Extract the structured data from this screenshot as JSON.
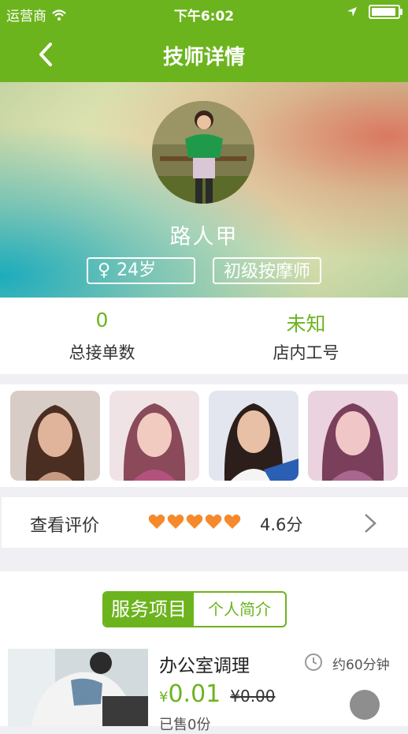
{
  "status_bar": {
    "carrier": "运营商",
    "time": "下午6:02"
  },
  "nav": {
    "title": "技师详情",
    "icons": [
      "back-arrow-icon"
    ]
  },
  "profile": {
    "name": "路人甲",
    "gender_symbol": "♀",
    "age": "24岁",
    "level": "初级按摩师"
  },
  "stats": [
    {
      "value": "0",
      "label": "总接单数"
    },
    {
      "value": "未知",
      "label": "店内工号"
    }
  ],
  "reviews": {
    "label": "查看评价",
    "hearts": "♥♥♥♥♥",
    "rating": 5,
    "score": "4.6分",
    "heart_color": "#f5892b"
  },
  "tabs": {
    "active": "服务项目",
    "inactive": "个人简介"
  },
  "service": {
    "name": "办公室调理",
    "duration": "约60分钟",
    "currency": "¥",
    "price": "0.01",
    "original_price": "¥0.00",
    "sold": "已售0份"
  },
  "colors": {
    "brand_green": "#6cb41d"
  }
}
